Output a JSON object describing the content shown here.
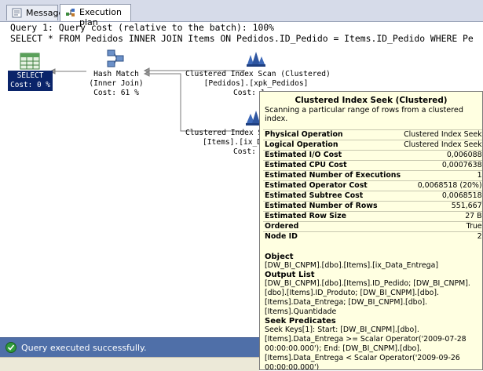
{
  "tabs": [
    {
      "label": "Messages",
      "icon": "messages-icon"
    },
    {
      "label": "Execution plan",
      "icon": "execution-plan-icon"
    }
  ],
  "query": {
    "line1": "Query 1: Query cost (relative to the batch): 100%",
    "line2": "SELECT * FROM Pedidos INNER JOIN Items ON Pedidos.ID_Pedido = Items.ID_Pedido WHERE Pe"
  },
  "plan": {
    "select": {
      "label": "SELECT",
      "cost": "Cost: 0 %"
    },
    "hash": {
      "line1": "Hash Match",
      "line2": "(Inner Join)",
      "line3": "Cost: 61 %"
    },
    "scan": {
      "line1": "Clustered Index Scan (Clustered)",
      "line2": "[Pedidos].[xpk_Pedidos]",
      "line3": "Cost: 1"
    },
    "seek": {
      "line1": "Clustered Index S",
      "line2": "[Items].[ix_D",
      "line3": "Cost:"
    }
  },
  "tooltip": {
    "title": "Clustered Index Seek (Clustered)",
    "description": "Scanning a particular range of rows from a clustered index.",
    "rows": [
      {
        "key": "Physical Operation",
        "value": "Clustered Index Seek"
      },
      {
        "key": "Logical Operation",
        "value": "Clustered Index Seek"
      },
      {
        "key": "Estimated I/O Cost",
        "value": "0,006088"
      },
      {
        "key": "Estimated CPU Cost",
        "value": "0,0007638"
      },
      {
        "key": "Estimated Number of Executions",
        "value": "1"
      },
      {
        "key": "Estimated Operator Cost",
        "value": "0,0068518 (20%)"
      },
      {
        "key": "Estimated Subtree Cost",
        "value": "0,0068518"
      },
      {
        "key": "Estimated Number of Rows",
        "value": "551,667"
      },
      {
        "key": "Estimated Row Size",
        "value": "27 B"
      },
      {
        "key": "Ordered",
        "value": "True"
      },
      {
        "key": "Node ID",
        "value": "2"
      }
    ],
    "object_label": "Object",
    "object_value": "[DW_BI_CNPM].[dbo].[Items].[ix_Data_Entrega]",
    "output_label": "Output List",
    "output_value": "[DW_BI_CNPM].[dbo].[Items].ID_Pedido; [DW_BI_CNPM].[dbo].[Items].ID_Produto; [DW_BI_CNPM].[dbo].[Items].Data_Entrega; [DW_BI_CNPM].[dbo].[Items].Quantidade",
    "seek_label": "Seek Predicates",
    "seek_value": "Seek Keys[1]: Start: [DW_BI_CNPM].[dbo].[Items].Data_Entrega >= Scalar Operator('2009-07-28 00:00:00.000'); End: [DW_BI_CNPM].[dbo].[Items].Data_Entrega < Scalar Operator('2009-09-26 00:00:00.000')"
  },
  "status": {
    "text": "Query executed successfully."
  },
  "colors": {
    "status_bar": "#4f6fa8",
    "tooltip_bg": "#ffffe1",
    "select_highlight": "#0a246a"
  }
}
